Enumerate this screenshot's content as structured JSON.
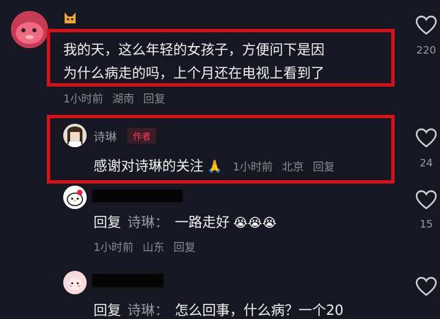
{
  "comments": [
    {
      "text_line1": "我的天，这么年轻的女孩子，方便问下是因",
      "text_line2": "为什么病走的吗，上个月还在电视上看到了",
      "time": "1小时前",
      "location": "湖南",
      "reply": "回复",
      "likes": "220",
      "avatar_icon": "pink-plush-toy-avatar",
      "emoji_icon": "cat-emoji-icon"
    }
  ],
  "replies": [
    {
      "author": "诗琳",
      "badge": "作者",
      "text": "感谢对诗琳的关注",
      "emoji": "🙏",
      "time": "1小时前",
      "location": "北京",
      "reply": "回复",
      "likes": "24"
    },
    {
      "prefix": "回复",
      "target": "诗琳：",
      "text": "一路走好",
      "emoji": "😭😭😭",
      "time": "1小时前",
      "location": "山东",
      "reply": "回复",
      "likes": "15",
      "avatar_icon": "hello-kitty-avatar"
    },
    {
      "prefix": "回复",
      "target": "诗琳：",
      "text": "怎么回事，什么病？一个20",
      "avatar_icon": "pink-cartoon-avatar"
    }
  ],
  "colors": {
    "background": "#161722",
    "highlight_box": "#d0121b",
    "author_badge": "#ff3b5c"
  }
}
